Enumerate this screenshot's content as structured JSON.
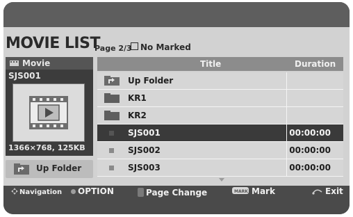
{
  "header": {
    "title": "MOVIE LIST",
    "page_info": "Page 2/3",
    "marked_status": "No Marked"
  },
  "preview": {
    "category_label": "Movie",
    "file_name": "SJS001",
    "resolution_size": "1366×768, 125KB"
  },
  "up_folder_button": {
    "label": "Up Folder"
  },
  "list": {
    "columns": {
      "title": "Title",
      "duration": "Duration"
    },
    "rows": [
      {
        "title": "Up Folder",
        "duration": "",
        "type": "up-folder",
        "selected": false
      },
      {
        "title": "KR1",
        "duration": "",
        "type": "folder",
        "selected": false
      },
      {
        "title": "KR2",
        "duration": "",
        "type": "folder",
        "selected": false
      },
      {
        "title": "SJS001",
        "duration": "00:00:00",
        "type": "file",
        "selected": true
      },
      {
        "title": "SJS002",
        "duration": "00:00:00",
        "type": "file",
        "selected": false
      },
      {
        "title": "SJS003",
        "duration": "00:00:00",
        "type": "file",
        "selected": false
      }
    ]
  },
  "footer": {
    "navigation": "Navigation",
    "option": "OPTION",
    "page_change": "Page Change",
    "mark_key": "MARK",
    "mark": "Mark",
    "exit": "Exit"
  },
  "icons": {
    "movie": "film-icon",
    "thumbnail": "film-play-icon",
    "up_folder": "up-folder-icon",
    "folder": "folder-icon",
    "file": "file-bullet-icon",
    "navigation": "navigation-arrows-icon",
    "option": "option-dot-icon",
    "page_change": "page-key-icon",
    "mark": "mark-key-icon",
    "exit": "exit-back-icon"
  },
  "colors": {
    "panel_dark": "#4a4a4a",
    "content_bg": "#d2d2d2",
    "selected_row": "#3a3a3a",
    "list_header": "#8c8c8c"
  }
}
